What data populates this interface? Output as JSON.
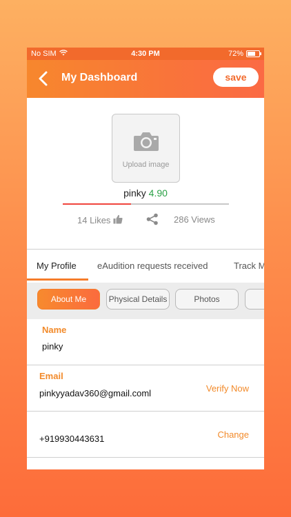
{
  "status_bar": {
    "carrier": "No SIM",
    "time": "4:30 PM",
    "battery_percent": "72%",
    "battery_level": 0.72
  },
  "header": {
    "title": "My Dashboard",
    "save_label": "save"
  },
  "profile": {
    "upload_label": "Upload image",
    "name": "pinky",
    "rating": "4.90",
    "rating_progress": 0.41,
    "likes": "14 Likes",
    "views": "286 Views"
  },
  "tabs": [
    {
      "label": "My Profile",
      "active": true
    },
    {
      "label": "eAudition requests received",
      "active": false
    },
    {
      "label": "Track M",
      "active": false
    }
  ],
  "chips": [
    {
      "label": "About Me",
      "active": true
    },
    {
      "label": "Physical Details",
      "active": false
    },
    {
      "label": "Photos",
      "active": false
    },
    {
      "label": "",
      "active": false
    }
  ],
  "fields": {
    "name": {
      "label": "Name",
      "value": "pinky"
    },
    "email": {
      "label": "Email",
      "value": "pinkyyadav360@gmail.coml",
      "action": "Verify Now"
    },
    "phone": {
      "value": "+919930443631",
      "action": "Change"
    }
  },
  "colors": {
    "accent": "#f57c2a",
    "rating": "#2aa146",
    "progress": "#f0443c"
  }
}
